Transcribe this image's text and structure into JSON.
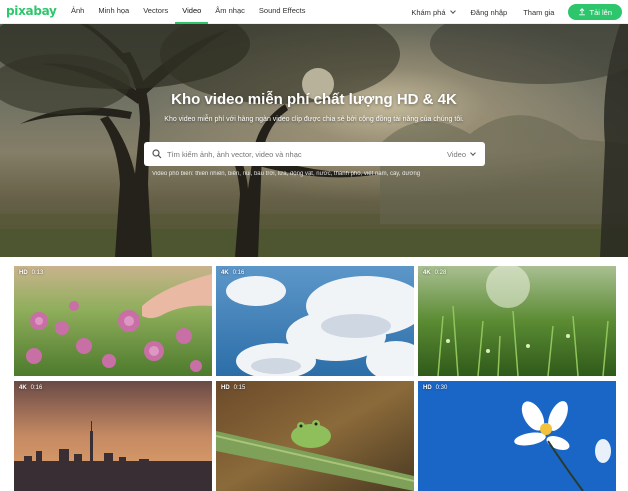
{
  "header": {
    "logo": "pixabay",
    "nav": [
      "Ảnh",
      "Minh họa",
      "Vectors",
      "Video",
      "Âm nhạc",
      "Sound Effects"
    ],
    "active_nav": "Video",
    "explore": "Khám phá",
    "login": "Đăng nhập",
    "join": "Tham gia",
    "upload": "Tải lên"
  },
  "hero": {
    "title": "Kho video miễn phí chất lượng HD & 4K",
    "subtitle": "Kho video miễn phí với hàng ngàn video clip được chia sẻ bởi cộng đồng tài năng của chúng tôi.",
    "search_placeholder": "Tìm kiếm ảnh, ảnh vector, video và nhạc",
    "search_type": "Video",
    "tags": "Video phổ biến: thiên nhiên, biển, núi, bầu trời, lửa, động vật, nước, thành phố, việt nam, cây, đường"
  },
  "videos": [
    {
      "quality": "HD",
      "duration": "0:13",
      "scene": "pink-flowers"
    },
    {
      "quality": "4K",
      "duration": "0:16",
      "scene": "clouds-sky"
    },
    {
      "quality": "4K",
      "duration": "0:28",
      "scene": "green-grass"
    },
    {
      "quality": "4K",
      "duration": "0:16",
      "scene": "city-sunset"
    },
    {
      "quality": "HD",
      "duration": "0:15",
      "scene": "frog-bamboo"
    },
    {
      "quality": "HD",
      "duration": "0:30",
      "scene": "white-flower-blue-sky"
    }
  ],
  "colors": {
    "brand": "#2ec66d"
  }
}
